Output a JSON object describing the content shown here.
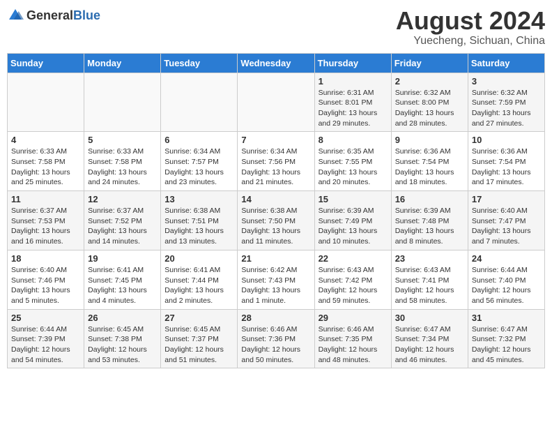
{
  "logo": {
    "text_general": "General",
    "text_blue": "Blue"
  },
  "title": {
    "month": "August 2024",
    "location": "Yuecheng, Sichuan, China"
  },
  "weekdays": [
    "Sunday",
    "Monday",
    "Tuesday",
    "Wednesday",
    "Thursday",
    "Friday",
    "Saturday"
  ],
  "weeks": [
    [
      {
        "day": "",
        "info": ""
      },
      {
        "day": "",
        "info": ""
      },
      {
        "day": "",
        "info": ""
      },
      {
        "day": "",
        "info": ""
      },
      {
        "day": "1",
        "info": "Sunrise: 6:31 AM\nSunset: 8:01 PM\nDaylight: 13 hours\nand 29 minutes."
      },
      {
        "day": "2",
        "info": "Sunrise: 6:32 AM\nSunset: 8:00 PM\nDaylight: 13 hours\nand 28 minutes."
      },
      {
        "day": "3",
        "info": "Sunrise: 6:32 AM\nSunset: 7:59 PM\nDaylight: 13 hours\nand 27 minutes."
      }
    ],
    [
      {
        "day": "4",
        "info": "Sunrise: 6:33 AM\nSunset: 7:58 PM\nDaylight: 13 hours\nand 25 minutes."
      },
      {
        "day": "5",
        "info": "Sunrise: 6:33 AM\nSunset: 7:58 PM\nDaylight: 13 hours\nand 24 minutes."
      },
      {
        "day": "6",
        "info": "Sunrise: 6:34 AM\nSunset: 7:57 PM\nDaylight: 13 hours\nand 23 minutes."
      },
      {
        "day": "7",
        "info": "Sunrise: 6:34 AM\nSunset: 7:56 PM\nDaylight: 13 hours\nand 21 minutes."
      },
      {
        "day": "8",
        "info": "Sunrise: 6:35 AM\nSunset: 7:55 PM\nDaylight: 13 hours\nand 20 minutes."
      },
      {
        "day": "9",
        "info": "Sunrise: 6:36 AM\nSunset: 7:54 PM\nDaylight: 13 hours\nand 18 minutes."
      },
      {
        "day": "10",
        "info": "Sunrise: 6:36 AM\nSunset: 7:54 PM\nDaylight: 13 hours\nand 17 minutes."
      }
    ],
    [
      {
        "day": "11",
        "info": "Sunrise: 6:37 AM\nSunset: 7:53 PM\nDaylight: 13 hours\nand 16 minutes."
      },
      {
        "day": "12",
        "info": "Sunrise: 6:37 AM\nSunset: 7:52 PM\nDaylight: 13 hours\nand 14 minutes."
      },
      {
        "day": "13",
        "info": "Sunrise: 6:38 AM\nSunset: 7:51 PM\nDaylight: 13 hours\nand 13 minutes."
      },
      {
        "day": "14",
        "info": "Sunrise: 6:38 AM\nSunset: 7:50 PM\nDaylight: 13 hours\nand 11 minutes."
      },
      {
        "day": "15",
        "info": "Sunrise: 6:39 AM\nSunset: 7:49 PM\nDaylight: 13 hours\nand 10 minutes."
      },
      {
        "day": "16",
        "info": "Sunrise: 6:39 AM\nSunset: 7:48 PM\nDaylight: 13 hours\nand 8 minutes."
      },
      {
        "day": "17",
        "info": "Sunrise: 6:40 AM\nSunset: 7:47 PM\nDaylight: 13 hours\nand 7 minutes."
      }
    ],
    [
      {
        "day": "18",
        "info": "Sunrise: 6:40 AM\nSunset: 7:46 PM\nDaylight: 13 hours\nand 5 minutes."
      },
      {
        "day": "19",
        "info": "Sunrise: 6:41 AM\nSunset: 7:45 PM\nDaylight: 13 hours\nand 4 minutes."
      },
      {
        "day": "20",
        "info": "Sunrise: 6:41 AM\nSunset: 7:44 PM\nDaylight: 13 hours\nand 2 minutes."
      },
      {
        "day": "21",
        "info": "Sunrise: 6:42 AM\nSunset: 7:43 PM\nDaylight: 13 hours\nand 1 minute."
      },
      {
        "day": "22",
        "info": "Sunrise: 6:43 AM\nSunset: 7:42 PM\nDaylight: 12 hours\nand 59 minutes."
      },
      {
        "day": "23",
        "info": "Sunrise: 6:43 AM\nSunset: 7:41 PM\nDaylight: 12 hours\nand 58 minutes."
      },
      {
        "day": "24",
        "info": "Sunrise: 6:44 AM\nSunset: 7:40 PM\nDaylight: 12 hours\nand 56 minutes."
      }
    ],
    [
      {
        "day": "25",
        "info": "Sunrise: 6:44 AM\nSunset: 7:39 PM\nDaylight: 12 hours\nand 54 minutes."
      },
      {
        "day": "26",
        "info": "Sunrise: 6:45 AM\nSunset: 7:38 PM\nDaylight: 12 hours\nand 53 minutes."
      },
      {
        "day": "27",
        "info": "Sunrise: 6:45 AM\nSunset: 7:37 PM\nDaylight: 12 hours\nand 51 minutes."
      },
      {
        "day": "28",
        "info": "Sunrise: 6:46 AM\nSunset: 7:36 PM\nDaylight: 12 hours\nand 50 minutes."
      },
      {
        "day": "29",
        "info": "Sunrise: 6:46 AM\nSunset: 7:35 PM\nDaylight: 12 hours\nand 48 minutes."
      },
      {
        "day": "30",
        "info": "Sunrise: 6:47 AM\nSunset: 7:34 PM\nDaylight: 12 hours\nand 46 minutes."
      },
      {
        "day": "31",
        "info": "Sunrise: 6:47 AM\nSunset: 7:32 PM\nDaylight: 12 hours\nand 45 minutes."
      }
    ]
  ]
}
